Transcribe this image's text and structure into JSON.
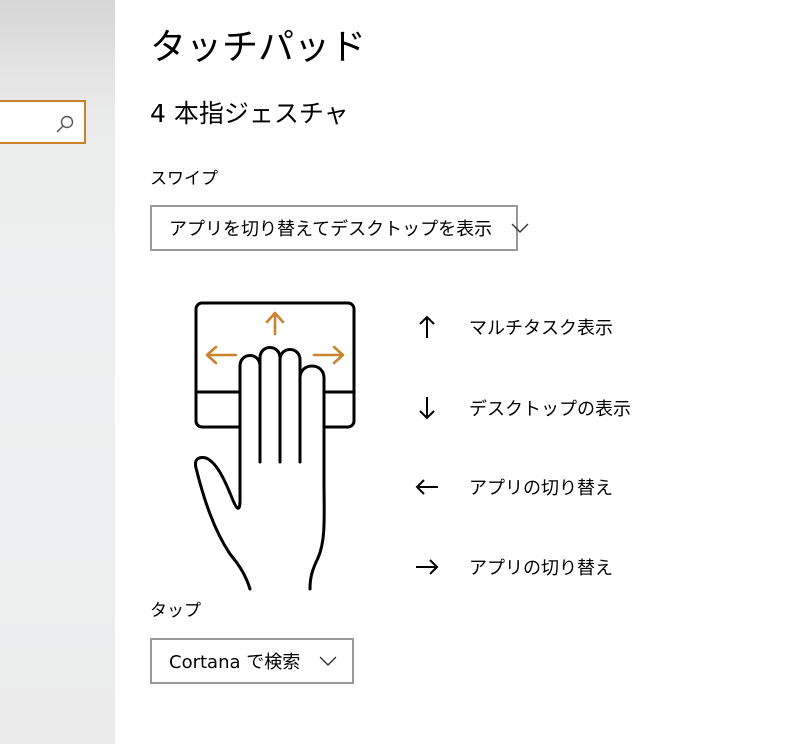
{
  "colors": {
    "accent": "#c9832e",
    "dropdown_border": "#999999",
    "text": "#000000"
  },
  "sidebar": {
    "search_placeholder": ""
  },
  "page": {
    "title": "タッチパッド",
    "section_title": "4 本指ジェスチャ"
  },
  "swipe": {
    "label": "スワイプ",
    "selected": "アプリを切り替えてデスクトップを表示"
  },
  "gestures": [
    {
      "icon": "arrow-up-icon",
      "label": "マルチタスク表示"
    },
    {
      "icon": "arrow-down-icon",
      "label": "デスクトップの表示"
    },
    {
      "icon": "arrow-left-icon",
      "label": "アプリの切り替え"
    },
    {
      "icon": "arrow-right-icon",
      "label": "アプリの切り替え"
    }
  ],
  "tap": {
    "label": "タップ",
    "selected": "Cortana で検索"
  }
}
